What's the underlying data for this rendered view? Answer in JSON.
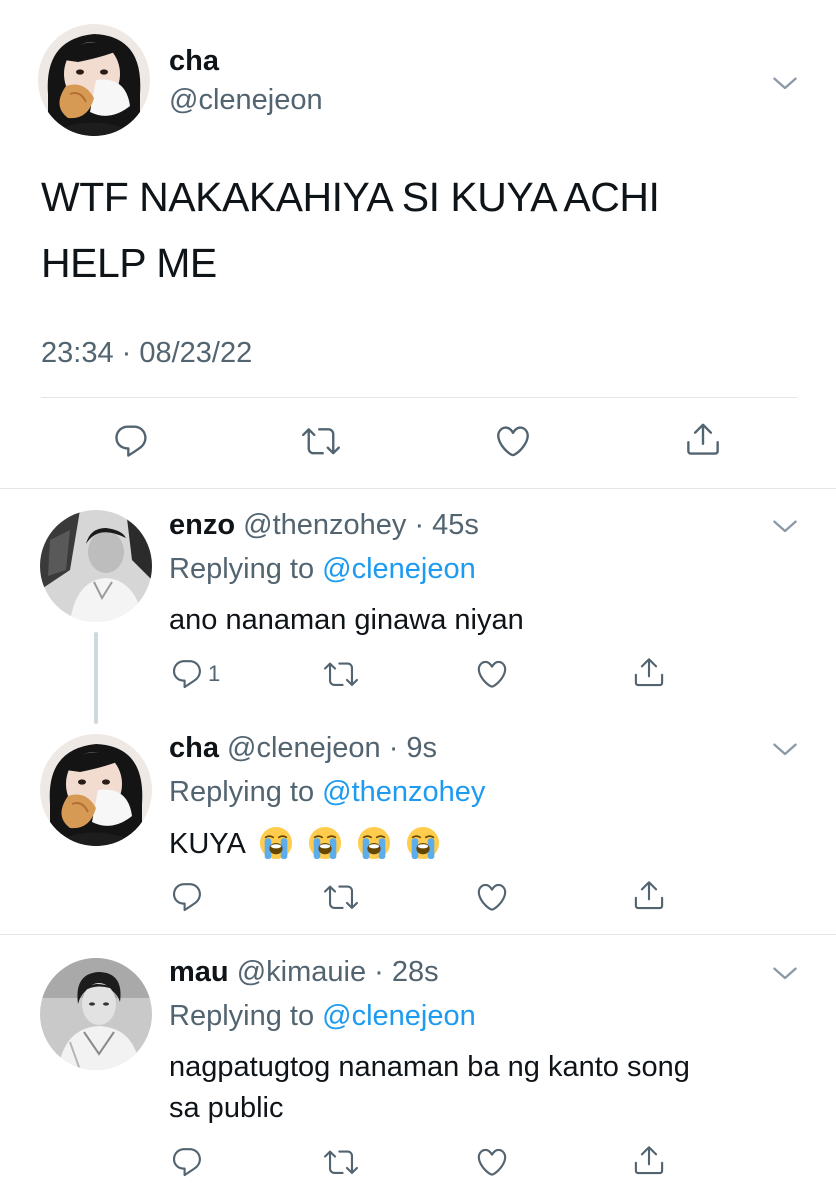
{
  "main_tweet": {
    "display_name": "cha",
    "handle": "@clenejeon",
    "text_line1": "WTF NAKAKAHIYA SI KUYA ACHI",
    "text_line2": "HELP ME",
    "timestamp": "23:34 · 08/23/22",
    "actions": [
      "reply-icon",
      "retweet-icon",
      "like-icon",
      "share-icon"
    ]
  },
  "replies": [
    {
      "display_name": "enzo",
      "handle_time": "@thenzohey · 45s",
      "replying_prefix": "Replying to",
      "replying_to": "@clenejeon",
      "text": "ano nanaman ginawa niyan",
      "reply_count": "1"
    },
    {
      "display_name": "cha",
      "handle_time": "@clenejeon · 9s",
      "replying_prefix": "Replying to",
      "replying_to": "@thenzohey",
      "text": "KUYA",
      "emojis": [
        "loudly-crying-face",
        "loudly-crying-face",
        "loudly-crying-face",
        "loudly-crying-face"
      ],
      "reply_count": ""
    },
    {
      "display_name": "mau",
      "handle_time": "@kimauie · 28s",
      "replying_prefix": "Replying to",
      "replying_to": "@clenejeon",
      "text_line1": "nagpatugtog nanaman ba ng kanto song",
      "text_line2": "sa public",
      "reply_count": ""
    }
  ],
  "colors": {
    "text": "#0f1419",
    "secondary": "#536471",
    "link": "#1d9bf0",
    "divider": "#e1e6ea",
    "thread_line": "#cfd9de"
  }
}
